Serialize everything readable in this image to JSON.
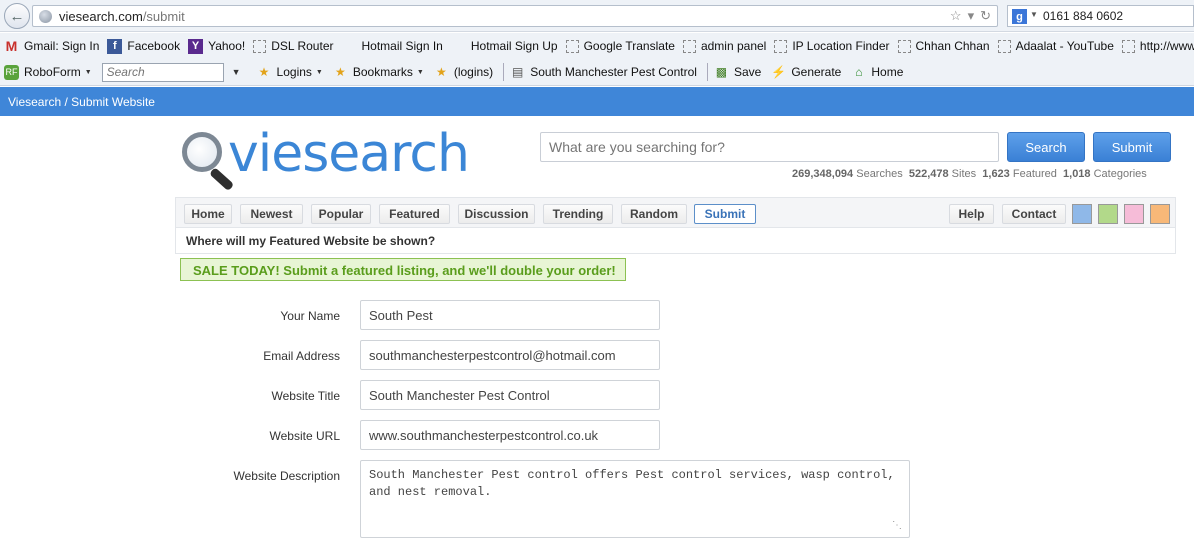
{
  "browser": {
    "url_host": "viesearch.com",
    "url_path": "/submit",
    "search_engine_value": "0161 884 0602",
    "bookmarks": [
      {
        "label": "Gmail: Sign In",
        "icon": "gmail-icon"
      },
      {
        "label": "Facebook",
        "icon": "facebook-icon"
      },
      {
        "label": "Yahoo!",
        "icon": "yahoo-icon"
      },
      {
        "label": "DSL Router",
        "icon": "page-icon"
      },
      {
        "label": "Hotmail Sign In",
        "icon": "windows-icon"
      },
      {
        "label": "Hotmail Sign Up",
        "icon": "windows-icon"
      },
      {
        "label": "Google Translate",
        "icon": "page-icon"
      },
      {
        "label": "admin panel",
        "icon": "page-icon"
      },
      {
        "label": "IP Location Finder",
        "icon": "page-icon"
      },
      {
        "label": "Chhan Chhan",
        "icon": "page-icon"
      },
      {
        "label": "Adaalat - YouTube",
        "icon": "page-icon"
      },
      {
        "label": "http://www",
        "icon": "page-icon"
      }
    ],
    "toolbar": {
      "roboform": "RoboForm",
      "search_placeholder": "Search",
      "logins": "Logins",
      "bookmarks": "Bookmarks",
      "logins_paren": "(logins)",
      "site_login": "South Manchester Pest Control",
      "save": "Save",
      "generate": "Generate",
      "home": "Home"
    }
  },
  "site": {
    "breadcrumb": "Viesearch / Submit Website",
    "logo_text": "viesearch",
    "search_placeholder": "What are you searching for?",
    "search_button": "Search",
    "submit_button": "Submit",
    "stats": {
      "searches_value": "269,348,094",
      "searches_label": "Searches",
      "sites_value": "522,478",
      "sites_label": "Sites",
      "featured_value": "1,623",
      "featured_label": "Featured",
      "categories_value": "1,018",
      "categories_label": "Categories"
    },
    "nav": {
      "home": "Home",
      "newest": "Newest",
      "popular": "Popular",
      "featured": "Featured",
      "discussion": "Discussion",
      "trending": "Trending",
      "random": "Random",
      "submit": "Submit",
      "help": "Help",
      "contact": "Contact"
    },
    "theme_swatches": [
      "#8fb8e8",
      "#b2d98a",
      "#f6bcd8",
      "#f8b878"
    ],
    "featured_question": "Where will my Featured Website be shown?",
    "sale_banner": "SALE TODAY! Submit a featured listing, and we'll double your order!",
    "form": {
      "name_label": "Your Name",
      "name_value": "South Pest",
      "email_label": "Email Address",
      "email_value": "southmanchesterpestcontrol@hotmail.com",
      "title_label": "Website Title",
      "title_value": "South Manchester Pest Control",
      "url_label": "Website URL",
      "url_value": "www.southmanchesterpestcontrol.co.uk",
      "description_label": "Website Description",
      "description_value": "South Manchester Pest control offers Pest control services, wasp control, and nest removal."
    }
  }
}
